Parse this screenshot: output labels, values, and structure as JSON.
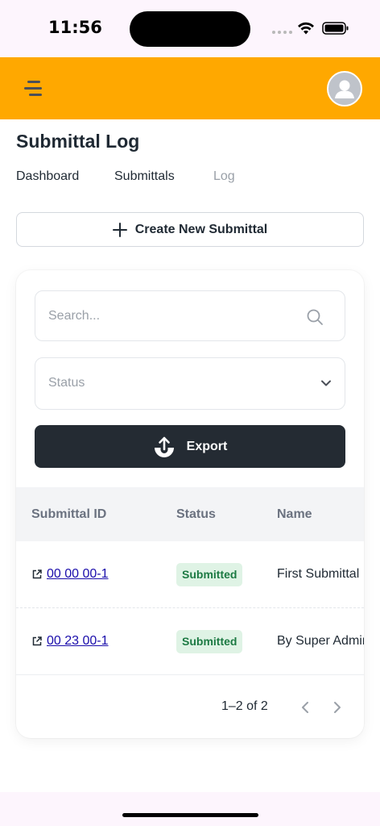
{
  "status_bar": {
    "time": "11:56"
  },
  "header": {
    "menu_icon": "menu-icon",
    "avatar_icon": "user-avatar-icon",
    "color": "#ffa800"
  },
  "page": {
    "title": "Submittal Log"
  },
  "breadcrumb": [
    {
      "label": "Dashboard",
      "active": false
    },
    {
      "label": "Submittals",
      "active": false
    },
    {
      "label": "Log",
      "active": true
    }
  ],
  "create_button": {
    "label": "Create New Submittal",
    "icon": "plus-icon"
  },
  "filters": {
    "search": {
      "placeholder": "Search...",
      "value": ""
    },
    "status": {
      "placeholder": "Status"
    }
  },
  "export_button": {
    "label": "Export",
    "icon": "upload-icon",
    "color": "#242b33"
  },
  "table": {
    "headers": [
      "Submittal ID",
      "Status",
      "Name"
    ],
    "rows": [
      {
        "id": "00 00 00-1",
        "status": "Submitted",
        "name": "First Submittal"
      },
      {
        "id": "00 23 00-1",
        "status": "Submitted",
        "name": "By Super Admin"
      }
    ]
  },
  "pagination": {
    "range": "1–2 of 2"
  },
  "colors": {
    "badge_bg": "#dff3e5",
    "badge_text": "#1c7a43",
    "link": "#1a0dab"
  }
}
